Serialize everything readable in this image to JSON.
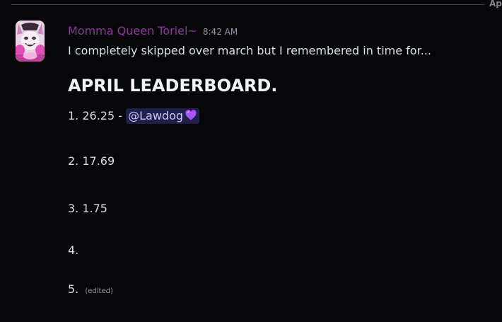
{
  "divider": {
    "label": "Ap"
  },
  "message": {
    "author": "Momma Queen Toriel~",
    "timestamp": "8:42 AM",
    "intro": "I completely skipped over march but I remembered in time for...",
    "heading": "APRIL LEADERBOARD.",
    "entries": [
      {
        "rank": "1.",
        "value": "26.25 -",
        "mention": "@Lawdog",
        "emoji": "purple-heart"
      },
      {
        "rank": "2.",
        "value": "17.69"
      },
      {
        "rank": "3.",
        "value": "1.75"
      },
      {
        "rank": "4.",
        "value": ""
      },
      {
        "rank": "5.",
        "value": ""
      }
    ],
    "edited_label": "(edited)"
  },
  "colors": {
    "username": "#8a3b99",
    "mention_bg": "#1e1f4a",
    "mention_text": "#c9cdfb",
    "heart": "#a855f7"
  }
}
